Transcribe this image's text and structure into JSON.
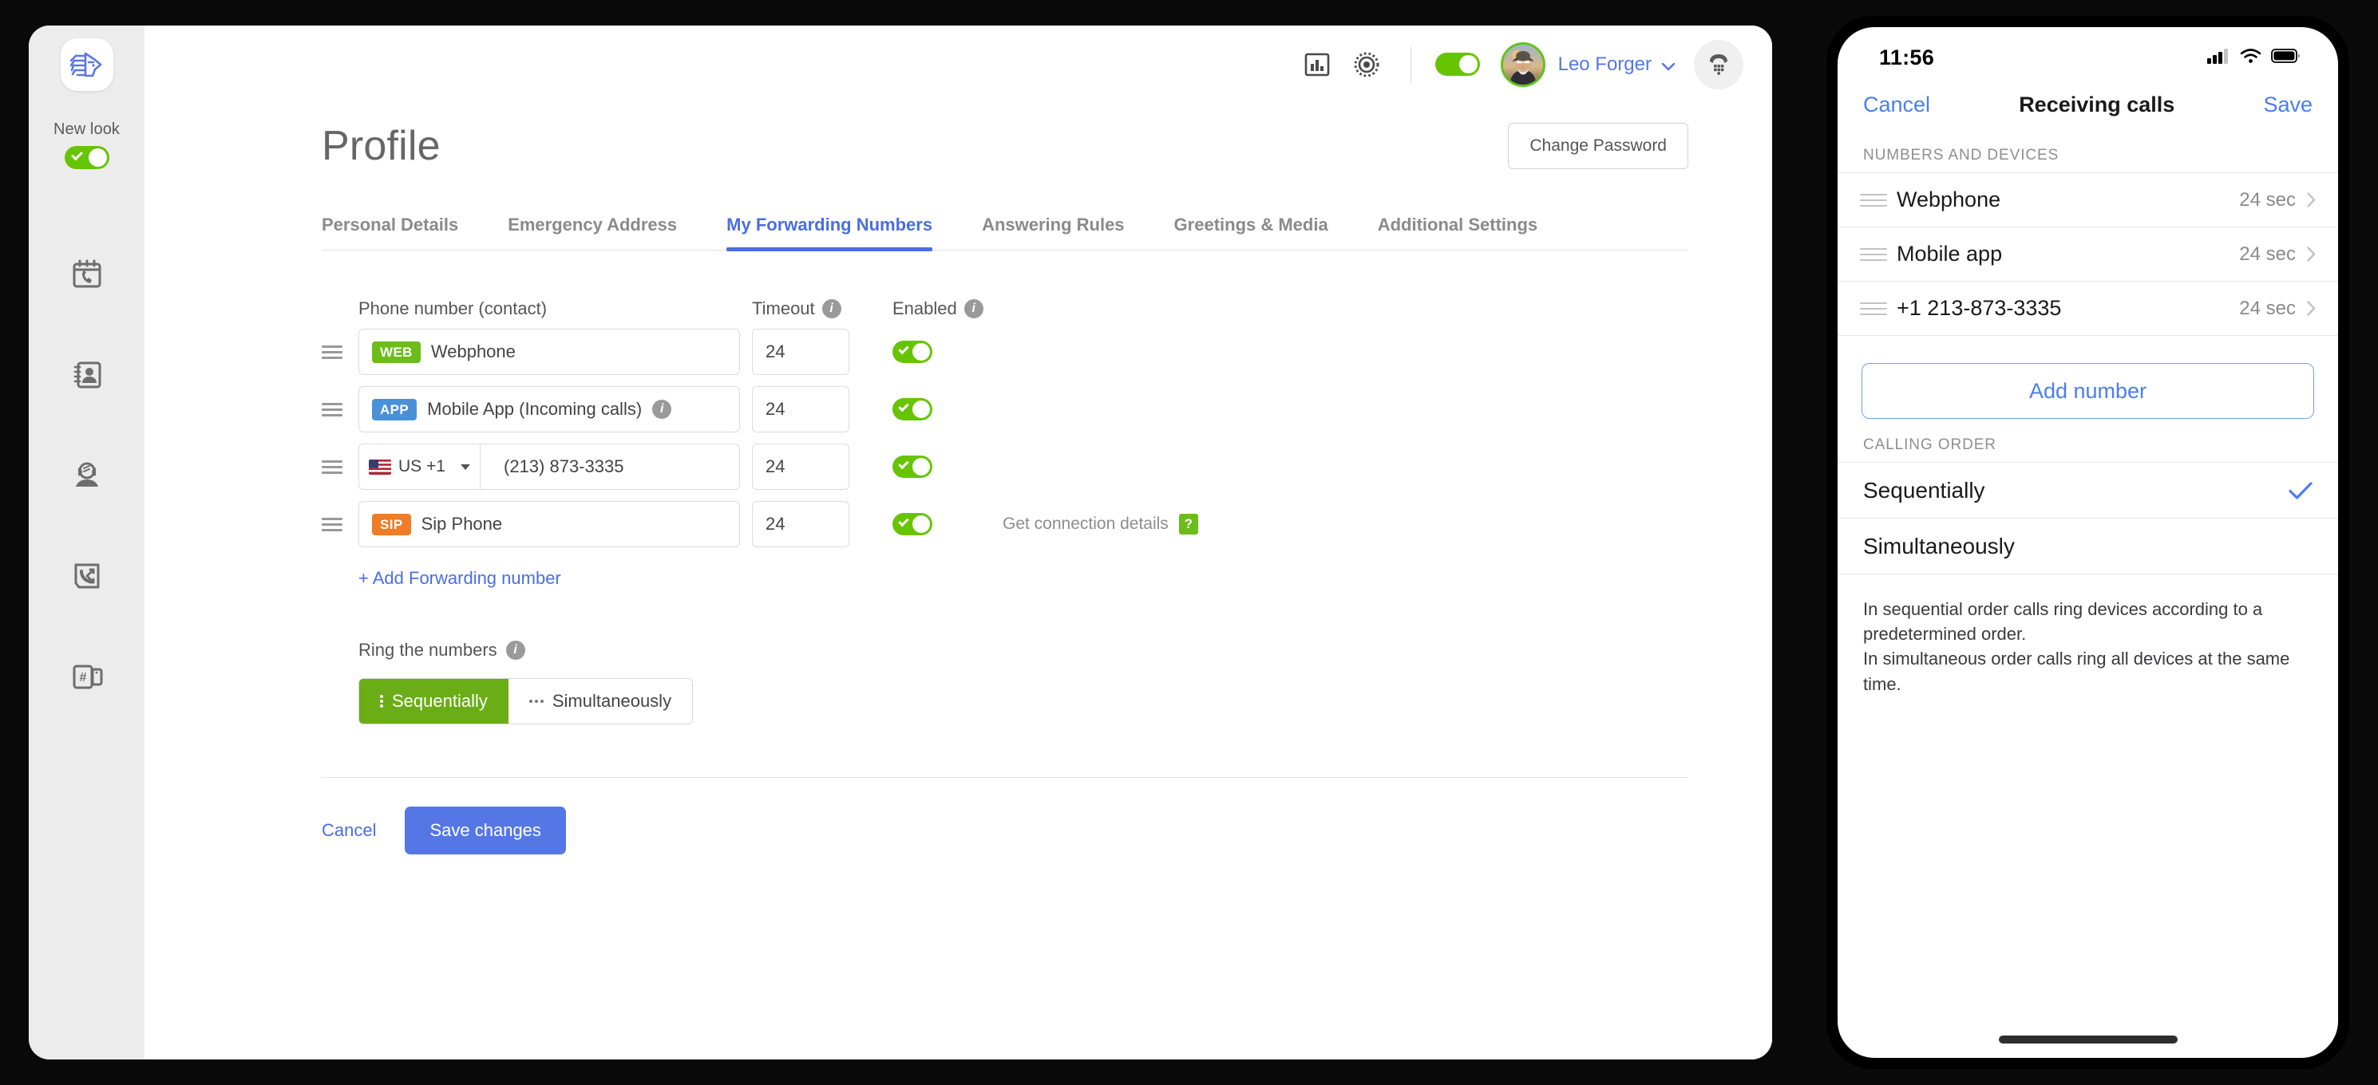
{
  "desktop": {
    "rail": {
      "logo_name": "wolf-head-logo",
      "new_look_label": "New look",
      "new_look_enabled": true,
      "icons": [
        {
          "name": "call-history-icon",
          "label": "Call History"
        },
        {
          "name": "contacts-icon",
          "label": "Contacts"
        },
        {
          "name": "agent-headset-icon",
          "label": "Agents"
        },
        {
          "name": "call-routing-icon",
          "label": "Call Routing"
        },
        {
          "name": "phone-numbers-icon",
          "label": "Numbers"
        }
      ]
    },
    "topbar": {
      "stats_icon": "bar-chart-icon",
      "settings_icon": "gear-icon",
      "status_toggle_on": true,
      "username": "Leo Forger",
      "chevron_icon": "chevron-down-icon",
      "dialpad_icon": "dialpad-icon"
    },
    "page": {
      "title": "Profile",
      "change_password_label": "Change Password"
    },
    "tabs": [
      {
        "label": "Personal Details",
        "active": false
      },
      {
        "label": "Emergency Address",
        "active": false
      },
      {
        "label": "My Forwarding Numbers",
        "active": true
      },
      {
        "label": "Answering Rules",
        "active": false
      },
      {
        "label": "Greetings & Media",
        "active": false
      },
      {
        "label": "Additional Settings",
        "active": false
      }
    ],
    "forwarding": {
      "col_phone": "Phone number (contact)",
      "col_timeout": "Timeout",
      "col_enabled": "Enabled",
      "rows": [
        {
          "badge": "WEB",
          "badge_color": "#6bbd1a",
          "label": "Webphone",
          "timeout": "24",
          "enabled": true,
          "has_info": false
        },
        {
          "badge": "APP",
          "badge_color": "#4a90d9",
          "label": "Mobile App (Incoming calls)",
          "timeout": "24",
          "enabled": true,
          "has_info": true
        },
        {
          "badge": "",
          "badge_color": "",
          "label": "",
          "country": "US +1",
          "number": "(213) 873-3335",
          "timeout": "24",
          "enabled": true,
          "has_info": false
        },
        {
          "badge": "SIP",
          "badge_color": "#f07c25",
          "label": "Sip Phone",
          "timeout": "24",
          "enabled": true,
          "has_info": false
        }
      ],
      "connection_details_label": "Get connection details",
      "connection_help_badge": "?",
      "add_forwarding_label": "+ Add Forwarding number"
    },
    "ring": {
      "label": "Ring the numbers",
      "options": [
        {
          "label": "Sequentially",
          "active": true
        },
        {
          "label": "Simultaneously",
          "active": false
        }
      ]
    },
    "footer": {
      "cancel_label": "Cancel",
      "save_label": "Save changes"
    }
  },
  "phone": {
    "status": {
      "time": "11:56",
      "signal_icon": "cellular-signal-icon",
      "wifi_icon": "wifi-icon",
      "battery_icon": "battery-icon"
    },
    "nav": {
      "cancel_label": "Cancel",
      "title": "Receiving calls",
      "save_label": "Save"
    },
    "numbers_section": {
      "header": "NUMBERS AND DEVICES",
      "rows": [
        {
          "label": "Webphone",
          "value": "24 sec"
        },
        {
          "label": "Mobile app",
          "value": "24 sec"
        },
        {
          "label": "+1 213-873-3335",
          "value": "24 sec"
        }
      ],
      "add_button_label": "Add number"
    },
    "order_section": {
      "header": "CALLING ORDER",
      "options": [
        {
          "label": "Sequentially",
          "selected": true
        },
        {
          "label": "Simultaneously",
          "selected": false
        }
      ],
      "description_line1": "In sequential order calls ring devices according to a predetermined order.",
      "description_line2": "In simultaneous order calls ring all devices at the same time."
    }
  },
  "colors": {
    "accent_blue": "#5577e6",
    "accent_green": "#67c400",
    "ios_blue": "#4a7ef0",
    "seg_green": "#6aad16"
  }
}
